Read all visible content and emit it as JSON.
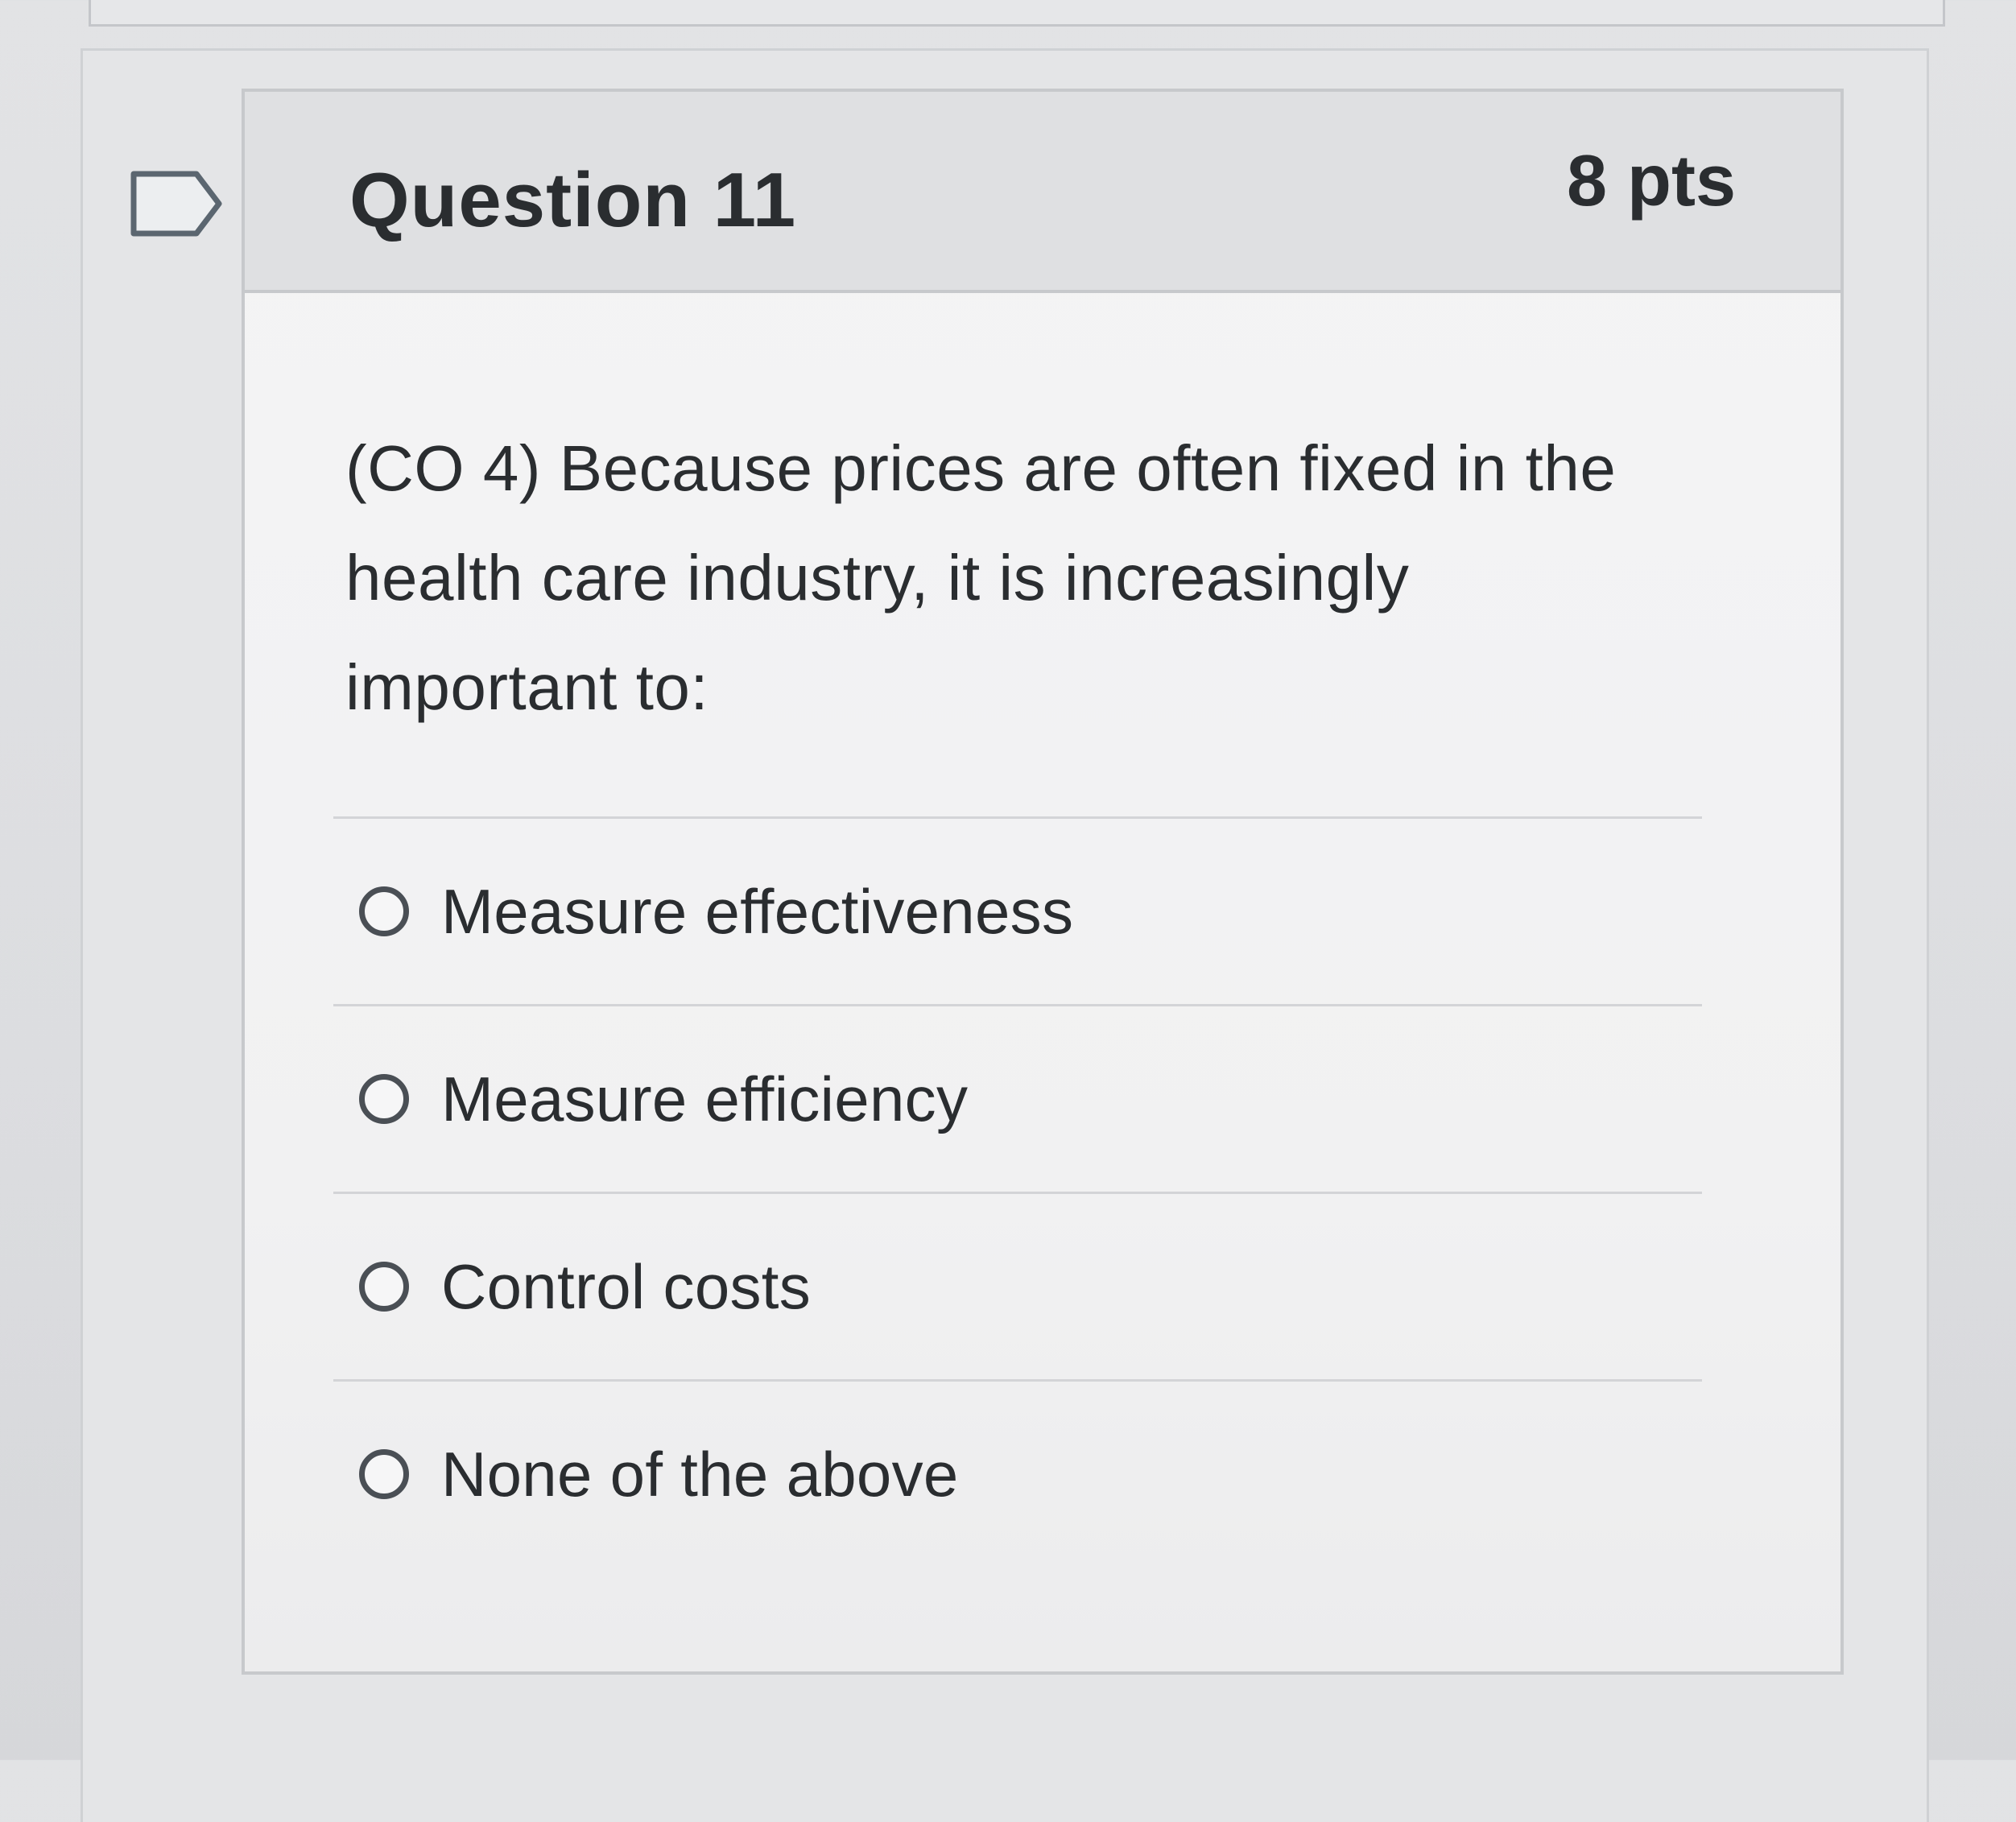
{
  "question": {
    "title": "Question 11",
    "points": "8 pts",
    "text": "(CO 4) Because prices are often fixed in the health care industry, it is increasingly important to:",
    "answers": [
      {
        "label": "Measure effectiveness",
        "selected": false
      },
      {
        "label": "Measure efficiency",
        "selected": false
      },
      {
        "label": "Control costs",
        "selected": false
      },
      {
        "label": "None of the above",
        "selected": false
      }
    ]
  },
  "icons": {
    "flag": "flag-bookmark-icon",
    "radio": "radio-unselected-icon"
  },
  "colors": {
    "header_bg": "#dfe0e2",
    "body_bg": "#f2f2f3",
    "text": "#2a2d30",
    "border": "#c7c9cc"
  }
}
